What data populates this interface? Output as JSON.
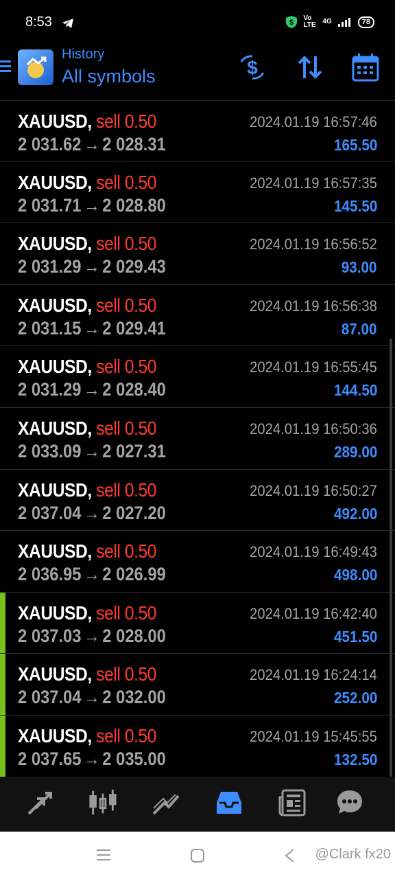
{
  "status_bar": {
    "time": "8:53",
    "network": "4G",
    "volte": "Vo LTE",
    "battery": "78"
  },
  "header": {
    "title": "History",
    "subtitle": "All symbols"
  },
  "trades": [
    {
      "symbol": "XAUUSD,",
      "side": "sell",
      "volume": "0.50",
      "open": "2 031.62",
      "close": "2 028.31",
      "datetime": "2024.01.19 16:57:46",
      "profit": "165.50",
      "marked": false
    },
    {
      "symbol": "XAUUSD,",
      "side": "sell",
      "volume": "0.50",
      "open": "2 031.71",
      "close": "2 028.80",
      "datetime": "2024.01.19 16:57:35",
      "profit": "145.50",
      "marked": false
    },
    {
      "symbol": "XAUUSD,",
      "side": "sell",
      "volume": "0.50",
      "open": "2 031.29",
      "close": "2 029.43",
      "datetime": "2024.01.19 16:56:52",
      "profit": "93.00",
      "marked": false
    },
    {
      "symbol": "XAUUSD,",
      "side": "sell",
      "volume": "0.50",
      "open": "2 031.15",
      "close": "2 029.41",
      "datetime": "2024.01.19 16:56:38",
      "profit": "87.00",
      "marked": false
    },
    {
      "symbol": "XAUUSD,",
      "side": "sell",
      "volume": "0.50",
      "open": "2 031.29",
      "close": "2 028.40",
      "datetime": "2024.01.19 16:55:45",
      "profit": "144.50",
      "marked": false
    },
    {
      "symbol": "XAUUSD,",
      "side": "sell",
      "volume": "0.50",
      "open": "2 033.09",
      "close": "2 027.31",
      "datetime": "2024.01.19 16:50:36",
      "profit": "289.00",
      "marked": false
    },
    {
      "symbol": "XAUUSD,",
      "side": "sell",
      "volume": "0.50",
      "open": "2 037.04",
      "close": "2 027.20",
      "datetime": "2024.01.19 16:50:27",
      "profit": "492.00",
      "marked": false
    },
    {
      "symbol": "XAUUSD,",
      "side": "sell",
      "volume": "0.50",
      "open": "2 036.95",
      "close": "2 026.99",
      "datetime": "2024.01.19 16:49:43",
      "profit": "498.00",
      "marked": false
    },
    {
      "symbol": "XAUUSD,",
      "side": "sell",
      "volume": "0.50",
      "open": "2 037.03",
      "close": "2 028.00",
      "datetime": "2024.01.19 16:42:40",
      "profit": "451.50",
      "marked": true
    },
    {
      "symbol": "XAUUSD,",
      "side": "sell",
      "volume": "0.50",
      "open": "2 037.04",
      "close": "2 032.00",
      "datetime": "2024.01.19 16:24:14",
      "profit": "252.00",
      "marked": true
    },
    {
      "symbol": "XAUUSD,",
      "side": "sell",
      "volume": "0.50",
      "open": "2 037.65",
      "close": "2 035.00",
      "datetime": "2024.01.19 15:45:55",
      "profit": "132.50",
      "marked": true
    }
  ],
  "arrow": "→",
  "bottom_tabs": [
    {
      "name": "quotes",
      "icon": "arrows-icon",
      "active": false
    },
    {
      "name": "chart",
      "icon": "candlestick-icon",
      "active": false
    },
    {
      "name": "trade",
      "icon": "trend-icon",
      "active": false
    },
    {
      "name": "history",
      "icon": "inbox-icon",
      "active": true
    },
    {
      "name": "news",
      "icon": "news-icon",
      "active": false
    },
    {
      "name": "chat",
      "icon": "chat-icon",
      "active": false
    }
  ],
  "watermark": "@Clark fx20",
  "colors": {
    "accent": "#3f8cff",
    "sell": "#ff3b30",
    "marker": "#7bbf1e",
    "muted": "#a4a4a4"
  }
}
